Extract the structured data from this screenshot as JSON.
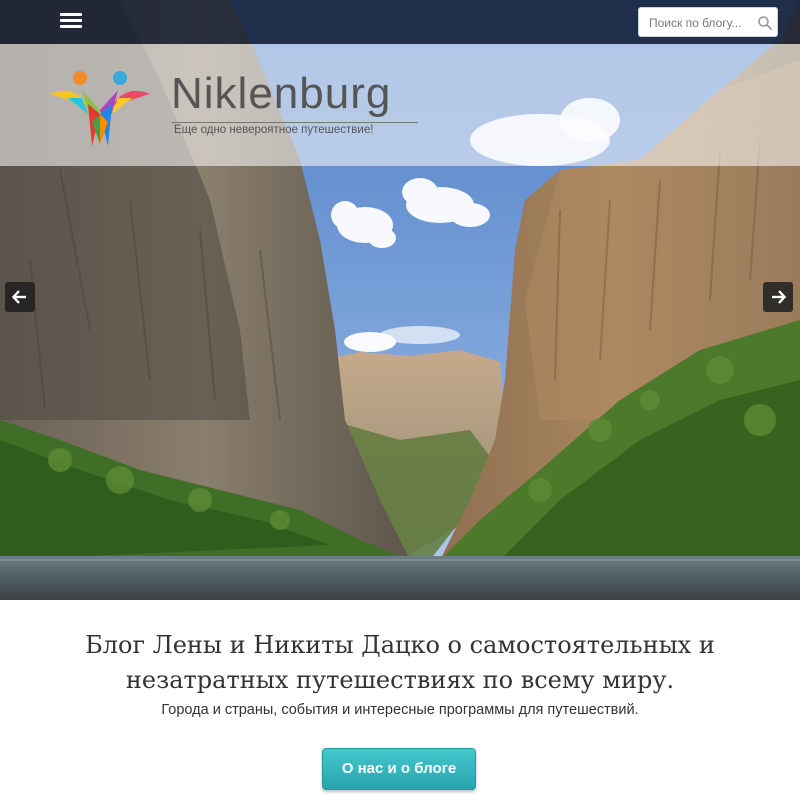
{
  "header": {
    "menu_icon": "hamburger-menu-icon",
    "search_placeholder": "Поиск по блогу...",
    "search_icon": "search-icon"
  },
  "brand": {
    "name": "Niklenburg",
    "tagline": "Еще одно невероятное путешествие!",
    "logo": "colorful-figures-logo"
  },
  "slider": {
    "prev_icon": "arrow-left-icon",
    "next_icon": "arrow-right-icon",
    "image": "canyon-river-landscape"
  },
  "intro": {
    "headline_line1": "Блог Лены и Никиты Дацко о самостоятельных и",
    "headline_line2": "незатратных путешествиях по всему миру.",
    "subline": "Города и страны, события и интересные программы для путешествий.",
    "cta_label": "О нас и о блоге"
  },
  "colors": {
    "topbar": "#1d2436",
    "cta": "#33b5bc",
    "text": "#333333",
    "brand": "#555555"
  }
}
